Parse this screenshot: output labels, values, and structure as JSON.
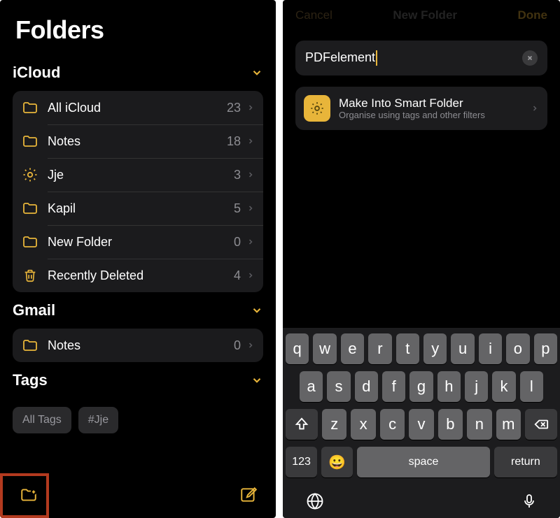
{
  "left": {
    "title": "Folders",
    "sections": [
      {
        "name": "iCloud",
        "items": [
          {
            "icon": "folder",
            "label": "All iCloud",
            "count": "23"
          },
          {
            "icon": "folder",
            "label": "Notes",
            "count": "18"
          },
          {
            "icon": "gear",
            "label": "Jje",
            "count": "3"
          },
          {
            "icon": "folder",
            "label": "Kapil",
            "count": "5"
          },
          {
            "icon": "folder",
            "label": "New Folder",
            "count": "0"
          },
          {
            "icon": "trash",
            "label": "Recently Deleted",
            "count": "4"
          }
        ]
      },
      {
        "name": "Gmail",
        "items": [
          {
            "icon": "folder",
            "label": "Notes",
            "count": "0"
          }
        ]
      }
    ],
    "tags_header": "Tags",
    "tags": [
      "All Tags",
      "#Jje"
    ]
  },
  "right": {
    "nav": {
      "cancel": "Cancel",
      "title": "New Folder",
      "done": "Done"
    },
    "name_value": "PDFelement",
    "smart": {
      "title": "Make Into Smart Folder",
      "sub": "Organise using tags and other filters"
    },
    "keyboard": {
      "r1": [
        "q",
        "w",
        "e",
        "r",
        "t",
        "y",
        "u",
        "i",
        "o",
        "p"
      ],
      "r2": [
        "a",
        "s",
        "d",
        "f",
        "g",
        "h",
        "j",
        "k",
        "l"
      ],
      "r3": [
        "z",
        "x",
        "c",
        "v",
        "b",
        "n",
        "m"
      ],
      "num": "123",
      "space": "space",
      "return": "return"
    }
  }
}
